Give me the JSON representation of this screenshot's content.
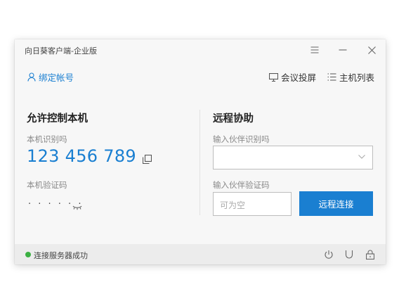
{
  "window": {
    "title": "向日葵客户端-企业版"
  },
  "toolbar": {
    "bind_account": "绑定帐号",
    "meeting_cast": "会议投屏",
    "host_list": "主机列表"
  },
  "allow_control": {
    "heading": "允许控制本机",
    "id_label": "本机识别吗",
    "device_id": "123 456 789",
    "code_label": "本机验证码",
    "code_masked": "· · · · · ·"
  },
  "remote_assist": {
    "heading": "远程协助",
    "partner_id_label": "输入伙伴识别吗",
    "partner_id_value": "",
    "partner_code_label": "输入伙伴验证码",
    "partner_code_placeholder": "可为空",
    "connect_button": "远程连接"
  },
  "status": {
    "text": "连接服务器成功",
    "color": "#3cb043"
  },
  "colors": {
    "accent": "#1a7fd1"
  },
  "icons": [
    "menu-icon",
    "minimize-icon",
    "close-icon",
    "user-icon",
    "cast-icon",
    "list-icon",
    "copy-icon",
    "eye-closed-icon",
    "chevron-down-icon",
    "power-icon",
    "magnet-icon",
    "lock-icon"
  ]
}
